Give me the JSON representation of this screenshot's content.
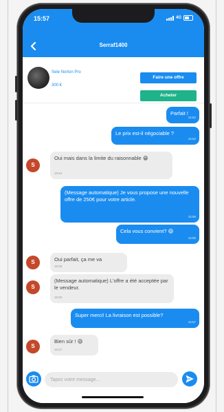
{
  "status_bar": {
    "time": "15:57",
    "network": "4G"
  },
  "header": {
    "title": "Serraf1400"
  },
  "product": {
    "name": "Sele Norton Pro",
    "price": "300 €",
    "offer_button": "Faire une offre",
    "buy_button": "Acheter"
  },
  "messages": [
    {
      "direction": "out",
      "text": "Parfait !",
      "time": "15:52"
    },
    {
      "direction": "out",
      "text": "Le prix est-il négociable ?",
      "time": "15:52"
    },
    {
      "direction": "in",
      "text": "Oui mais dans la limite du raisonnable 😁",
      "time": "15:54"
    },
    {
      "direction": "out",
      "text": "(Message automatique) Je vous propose une nouvelle offre de 250€ pour votre article.",
      "time": "15:55"
    },
    {
      "direction": "out",
      "text": "Cela vous convient? 😄",
      "time": "15:55"
    },
    {
      "direction": "in",
      "text": "Oui parfait, ça me va",
      "time": "15:55"
    },
    {
      "direction": "in",
      "text": "(Message automatique) L'offre a été acceptée par le vendeur.",
      "time": "15:56"
    },
    {
      "direction": "out",
      "text": "Super merci! La livraison est possible?",
      "time": "15:57"
    },
    {
      "direction": "in",
      "text": "Bien sûr ! 😄",
      "time": "15:57"
    }
  ],
  "avatar_letter": "S",
  "composer": {
    "placeholder": "Tapez votre message..."
  },
  "colors": {
    "primary": "#1a8cf0",
    "buy": "#1fb38a",
    "avatar": "#c4482a",
    "incoming": "#ececec"
  }
}
